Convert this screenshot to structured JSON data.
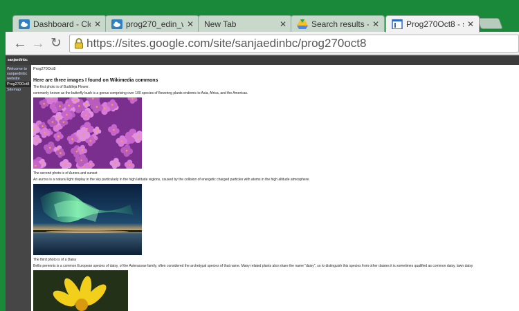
{
  "browser": {
    "tabs": [
      {
        "label": "Dashboard - Clc",
        "icon": "cloud-icon",
        "active": false
      },
      {
        "label": "prog270_edin_w",
        "icon": "cloud-icon",
        "active": false
      },
      {
        "label": "New Tab",
        "icon": "",
        "active": false
      },
      {
        "label": "Search results -",
        "icon": "google-drive-icon",
        "active": false
      },
      {
        "label": "Prog270Oct8 - s",
        "icon": "google-sites-icon",
        "active": true
      }
    ],
    "close_glyph": "✕",
    "back_glyph": "←",
    "forward_glyph": "→",
    "reload_glyph": "↻",
    "url": "https://sites.google.com/site/sanjaedinbc/prog270oct8"
  },
  "site": {
    "name": "sanjaedinbc",
    "sidebar": [
      {
        "label": "Welcome to",
        "current": false
      },
      {
        "label": "sanjaedinbc",
        "current": false
      },
      {
        "label": "website",
        "current": false
      },
      {
        "label": "Prog270Oct8",
        "current": true
      },
      {
        "label": "Sitemap",
        "current": false
      }
    ]
  },
  "page": {
    "breadcrumb": "Prog270Oct8",
    "heading": "Here are three images I found on Wikimedia commons",
    "photo1_caption": "The first photo is of Buddleja Flower.",
    "photo1_text": "commonly known as the butterfly bush is a genus comprising over 100 species of flowering plants endemic to Asia, Africa, and the Americas.",
    "photo2_caption": "The second photo is of Aurora and sunset",
    "photo2_text": "An aurora is a natural light display in the sky particularly in the high latitude regions, caused by the collision of energetic charged particles with atoms in the high altitude atmosphere.",
    "photo3_caption": "The third photo is of a Daisy",
    "photo3_text": "Bellis perennis is a common European species of daisy, of the Asteraceae family, often considered the archetypal species of that name. Many related plants also share the name \"daisy\", so to distinguish this species from other daisies it is sometimes qualified as common daisy, lawn daisy"
  },
  "colors": {
    "chrome_frame": "#1a8a3a",
    "site_header": "#3c3c3c",
    "sidebar": "#464646"
  }
}
